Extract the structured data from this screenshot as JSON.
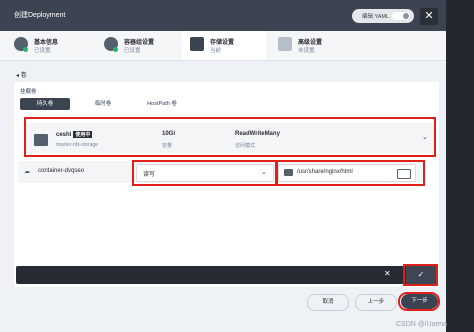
{
  "header": {
    "title": "创建Deployment",
    "yaml_label": "编辑 YAML"
  },
  "steps": [
    {
      "name": "基本信息",
      "status": "已设置"
    },
    {
      "name": "容器组设置",
      "status": "已设置"
    },
    {
      "name": "存储设置",
      "status": "当前"
    },
    {
      "name": "高级设置",
      "status": "未设置"
    }
  ],
  "section_title": "◂ 卷",
  "mount_label": "挂载卷",
  "tabs": [
    "持久卷",
    "临时卷",
    "HostPath 卷"
  ],
  "volume": {
    "name": "ceshi",
    "badge": "使用中",
    "source": "master-nfs-storage",
    "capacity": "10Gi",
    "capacity_label": "容量",
    "access_mode": "ReadWriteMany",
    "access_mode_label": "访问模式"
  },
  "mount": {
    "container": "container-dvqseo",
    "read_write": "读写",
    "mount_path": "/usr/share/nginx/html"
  },
  "actions": {
    "cancel": "取消",
    "prev": "上一步",
    "next": "下一步"
  },
  "watermark": "CSDN @iUaena",
  "colors": {
    "accent": "#3d4451",
    "highlight": "#e0201a"
  }
}
